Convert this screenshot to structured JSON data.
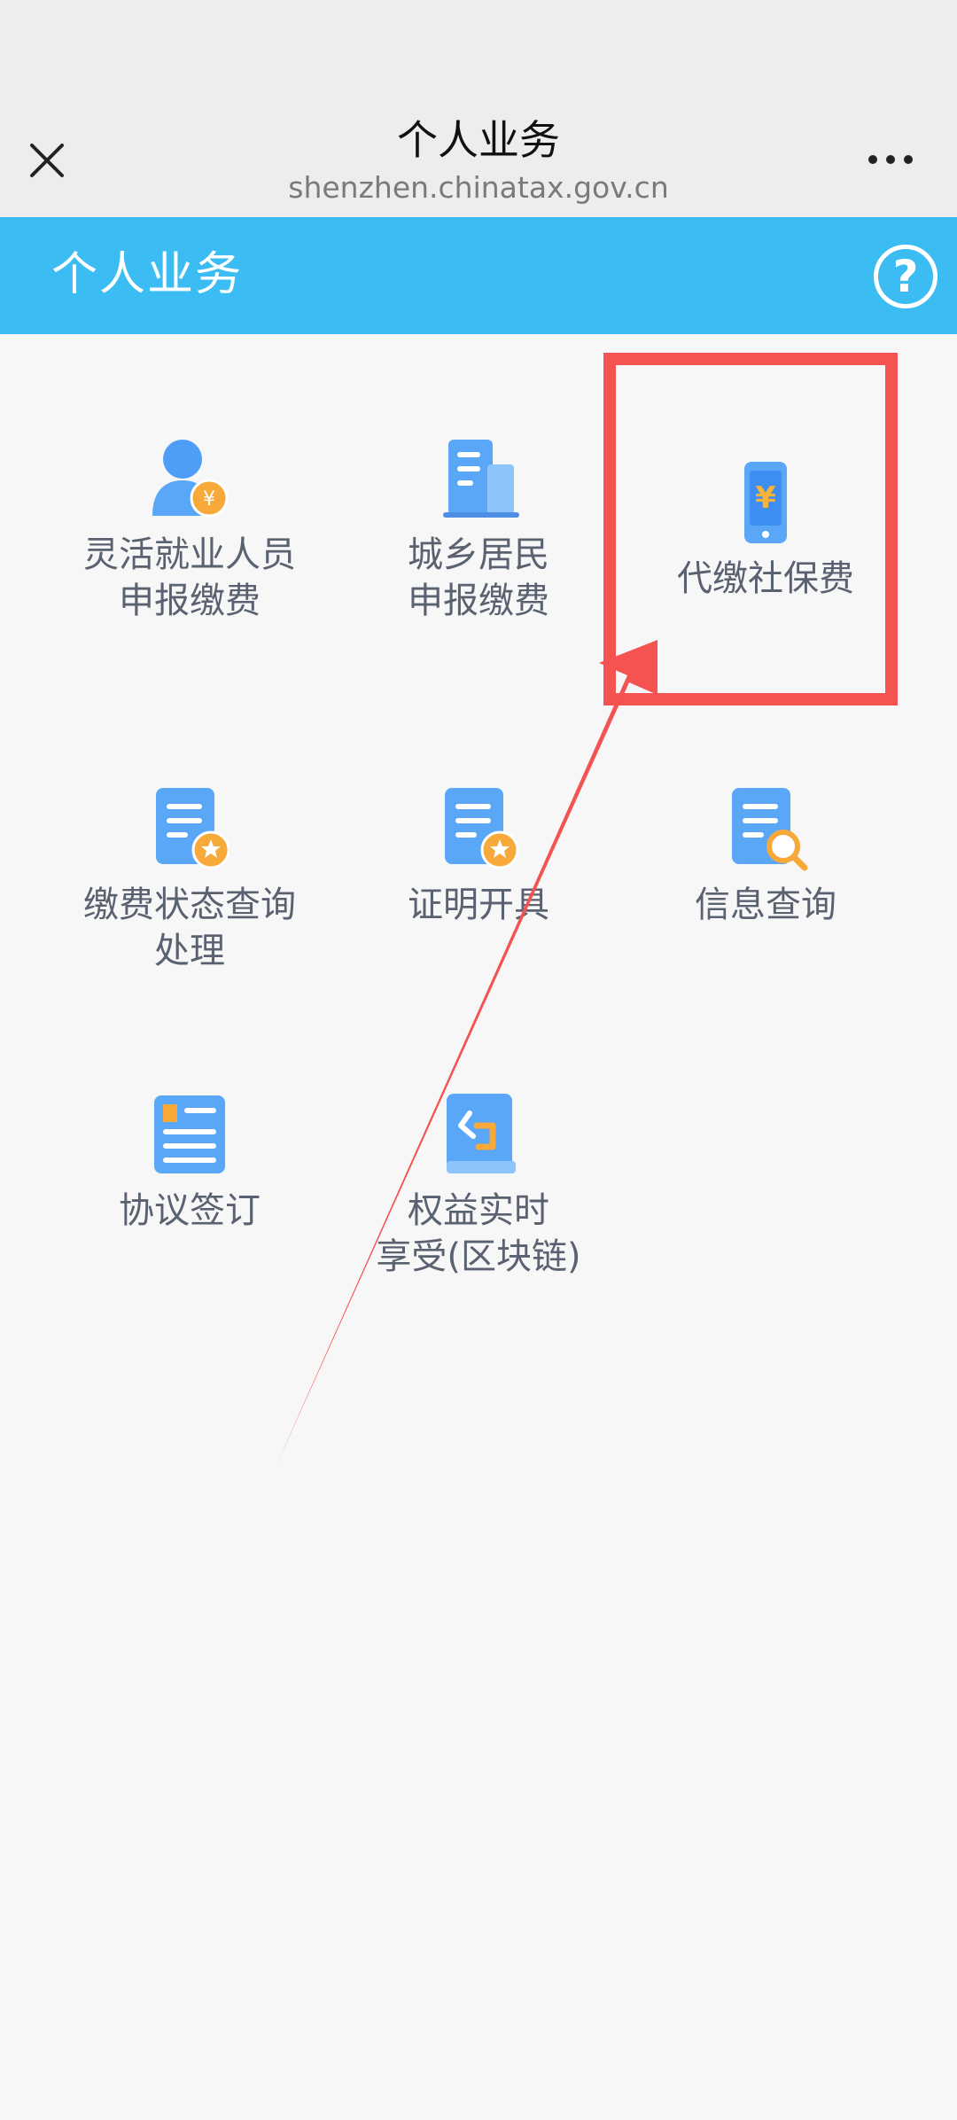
{
  "topbar": {
    "title": "个人业务",
    "url": "shenzhen.chinatax.gov.cn",
    "close_icon": "close-icon",
    "more_icon": "more-dots-icon"
  },
  "header": {
    "title": "个人业务",
    "help_symbol": "?",
    "background_color": "#3bbcf2"
  },
  "tiles": [
    {
      "line1": "灵活就业人员",
      "line2": "申报缴费",
      "icon": "person-yuan-icon"
    },
    {
      "line1": "城乡居民",
      "line2": "申报缴费",
      "icon": "building-icon"
    },
    {
      "line1": "代缴社保费",
      "line2": "",
      "icon": "phone-yuan-icon"
    },
    {
      "line1": "缴费状态查询",
      "line2": "处理",
      "icon": "document-star-icon"
    },
    {
      "line1": "证明开具",
      "line2": "",
      "icon": "document-star-icon"
    },
    {
      "line1": "信息查询",
      "line2": "",
      "icon": "document-search-icon"
    },
    {
      "line1": "协议签订",
      "line2": "",
      "icon": "agreement-icon"
    },
    {
      "line1": "权益实时",
      "line2": "享受(区块链)",
      "icon": "book-chain-icon"
    }
  ],
  "annotation": {
    "highlight_color": "#f55252"
  }
}
